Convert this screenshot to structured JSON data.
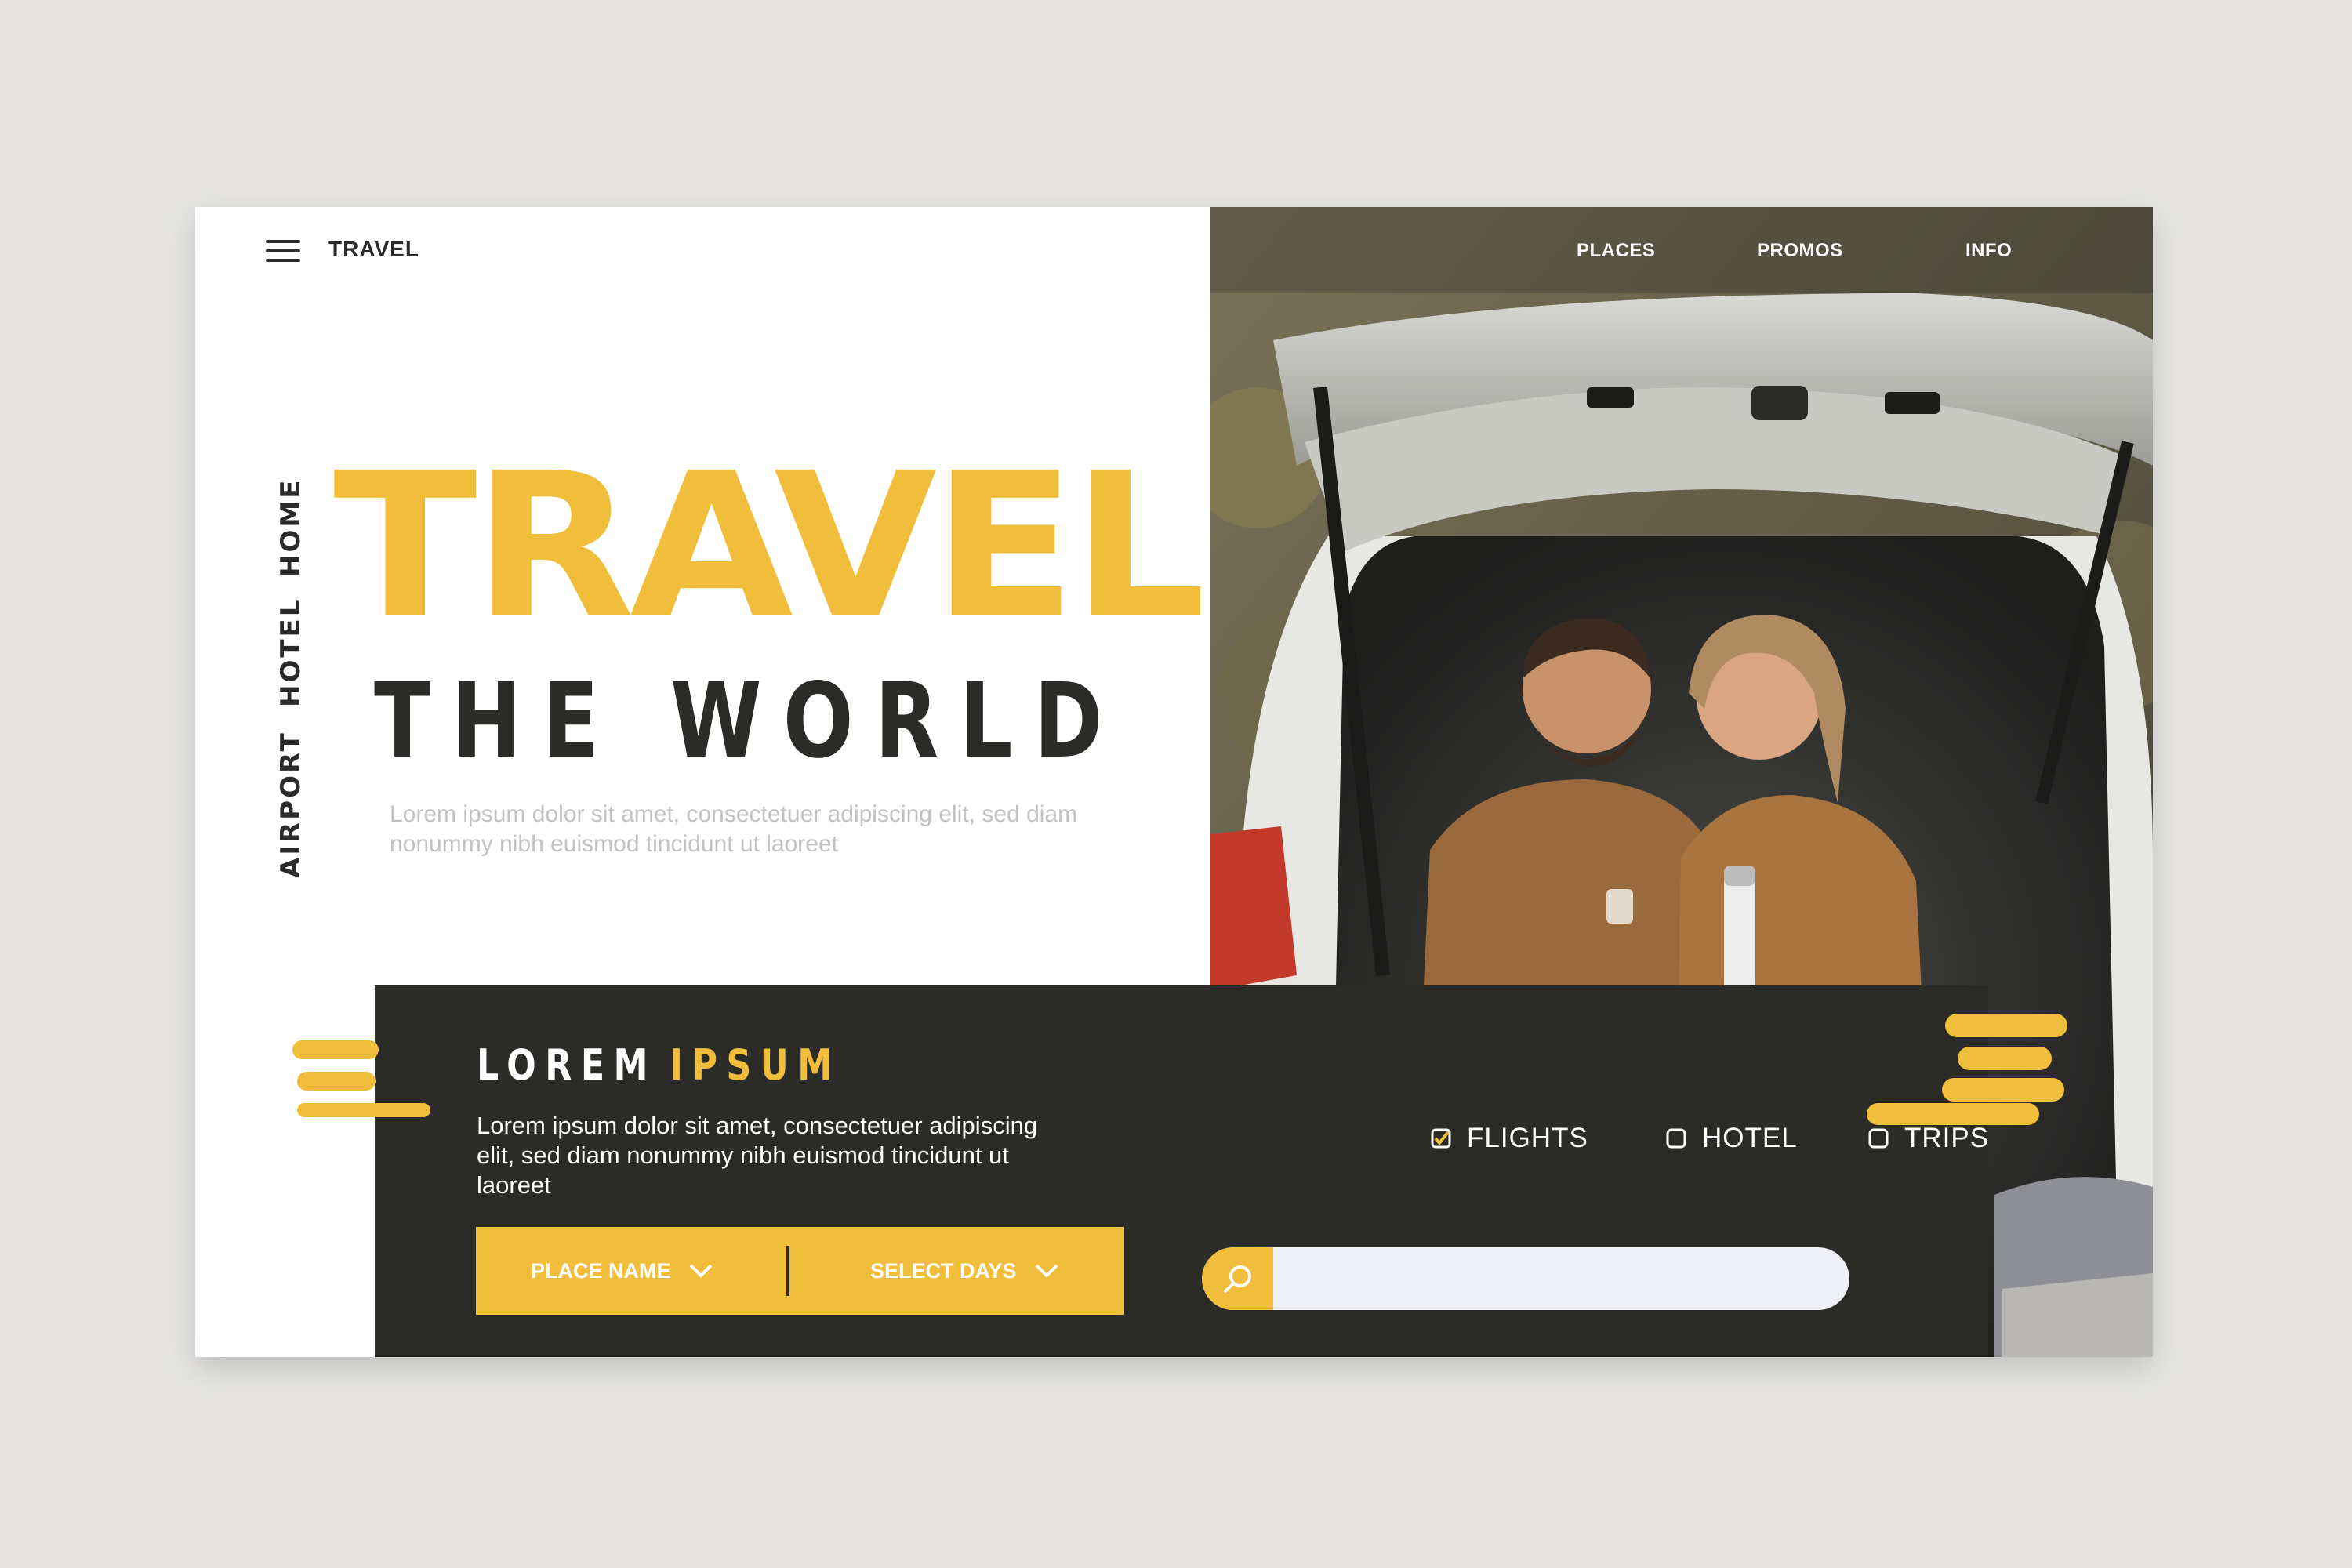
{
  "header": {
    "menu_icon": "hamburger-menu-icon",
    "brand": "TRAVEL",
    "nav": [
      "PLACES",
      "PROMOS",
      "INFO"
    ]
  },
  "side_nav": [
    "HOME",
    "HOTEL",
    "AIRPORT"
  ],
  "hero": {
    "title": "TRAVEL",
    "subtitle": "THE WORLD",
    "body": "Lorem ipsum dolor sit amet, consectetuer adipiscing elit, sed diam nonummy nibh euismod tincidunt ut laoreet"
  },
  "panel": {
    "title_white": "LOREM",
    "title_yellow": "IPSUM",
    "body": "Lorem ipsum dolor sit amet, consectetuer adipiscing elit, sed diam nonummy nibh euismod tincidunt ut laoreet",
    "place_picker": "PLACE NAME",
    "days_picker": "SELECT DAYS",
    "options": [
      {
        "label": "FLIGHTS",
        "checked": true
      },
      {
        "label": "HOTEL",
        "checked": false
      },
      {
        "label": "TRIPS",
        "checked": false
      }
    ],
    "search_value": "",
    "search_icon": "search-icon"
  },
  "colors": {
    "accent": "#f1be3c",
    "dark": "#2b2b28",
    "background": "#e6e5e3",
    "card": "#ffffff"
  }
}
